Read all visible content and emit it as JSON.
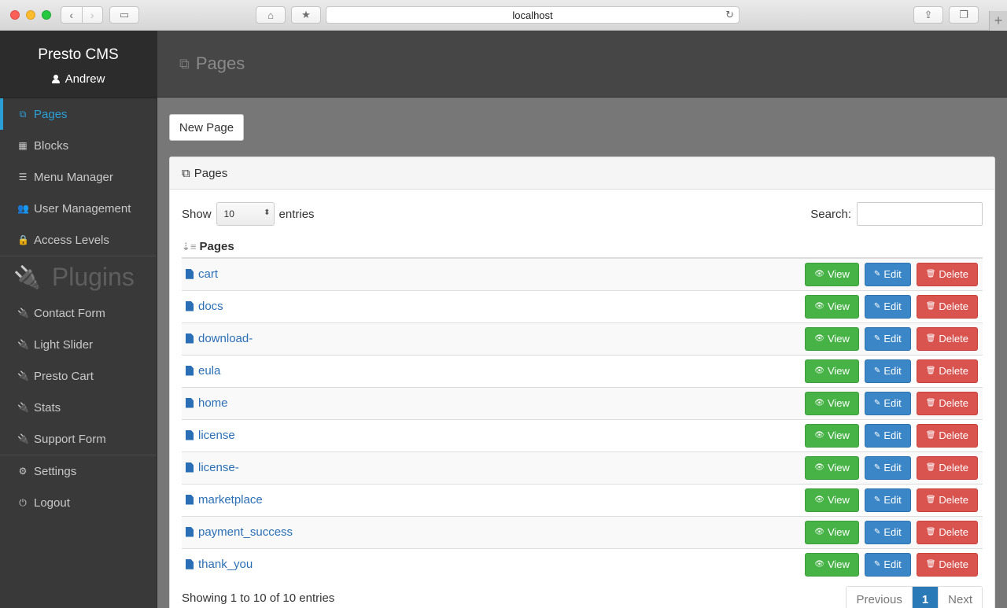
{
  "browser": {
    "url": "localhost"
  },
  "sidebar": {
    "app_title": "Presto CMS",
    "user_name": "Andrew",
    "main_menu": [
      {
        "label": "Pages",
        "icon": "pages-icon",
        "active": true
      },
      {
        "label": "Blocks",
        "icon": "blocks-icon",
        "active": false
      },
      {
        "label": "Menu Manager",
        "icon": "menu-icon",
        "active": false
      },
      {
        "label": "User Management",
        "icon": "users-icon",
        "active": false
      },
      {
        "label": "Access Levels",
        "icon": "lock-icon",
        "active": false
      }
    ],
    "plugins_heading": "Plugins",
    "plugins": [
      {
        "label": "Contact Form",
        "icon": "plug-icon"
      },
      {
        "label": "Light Slider",
        "icon": "plug-icon"
      },
      {
        "label": "Presto Cart",
        "icon": "plug-icon"
      },
      {
        "label": "Stats",
        "icon": "plug-icon"
      },
      {
        "label": "Support Form",
        "icon": "plug-icon"
      }
    ],
    "bottom_menu": [
      {
        "label": "Settings",
        "icon": "gear-icon"
      },
      {
        "label": "Logout",
        "icon": "power-icon"
      }
    ]
  },
  "main": {
    "header_title": "Pages",
    "new_page_label": "New Page",
    "panel_title": "Pages",
    "show_label": "Show",
    "entries_label": "entries",
    "page_length": "10",
    "search_label": "Search:",
    "search_value": "",
    "column_header": "Pages",
    "rows": [
      {
        "name": "cart"
      },
      {
        "name": "docs"
      },
      {
        "name": "download-"
      },
      {
        "name": "eula"
      },
      {
        "name": "home"
      },
      {
        "name": "license"
      },
      {
        "name": "license-"
      },
      {
        "name": "marketplace"
      },
      {
        "name": "payment_success"
      },
      {
        "name": "thank_you"
      }
    ],
    "view_label": "View",
    "edit_label": "Edit",
    "delete_label": "Delete",
    "info_text": "Showing 1 to 10 of 10 entries",
    "pager": {
      "previous": "Previous",
      "current": "1",
      "next": "Next"
    }
  },
  "colors": {
    "accent": "#2a9fd6",
    "view": "#47b347",
    "edit": "#3a86c6",
    "delete": "#d9534f"
  }
}
